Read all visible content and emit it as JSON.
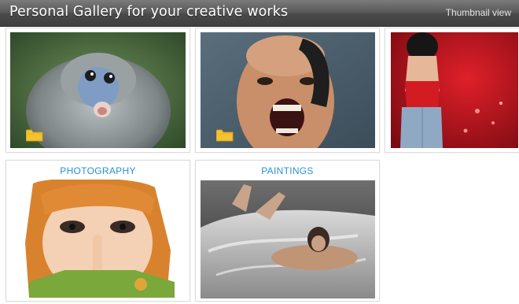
{
  "header": {
    "title": "Personal Gallery for your creative works",
    "view_label": "Thumbnail view"
  },
  "items": [
    {
      "caption": "",
      "image": "monkey-portrait",
      "has_folder": true
    },
    {
      "caption": "",
      "image": "screaming-man-portrait",
      "has_folder": true
    },
    {
      "caption": "",
      "image": "woman-red-background",
      "has_folder": false
    },
    {
      "caption": "PHOTOGRAPHY",
      "image": "girl-finger-on-lips",
      "has_folder": false
    },
    {
      "caption": "PAINTINGS",
      "image": "woman-on-bed",
      "has_folder": false
    }
  ],
  "colors": {
    "header_dark": "#3f3f3f",
    "caption_blue": "#2b8fd6",
    "folder_yellow": "#f4c430"
  },
  "icons": [
    "folder-icon"
  ]
}
